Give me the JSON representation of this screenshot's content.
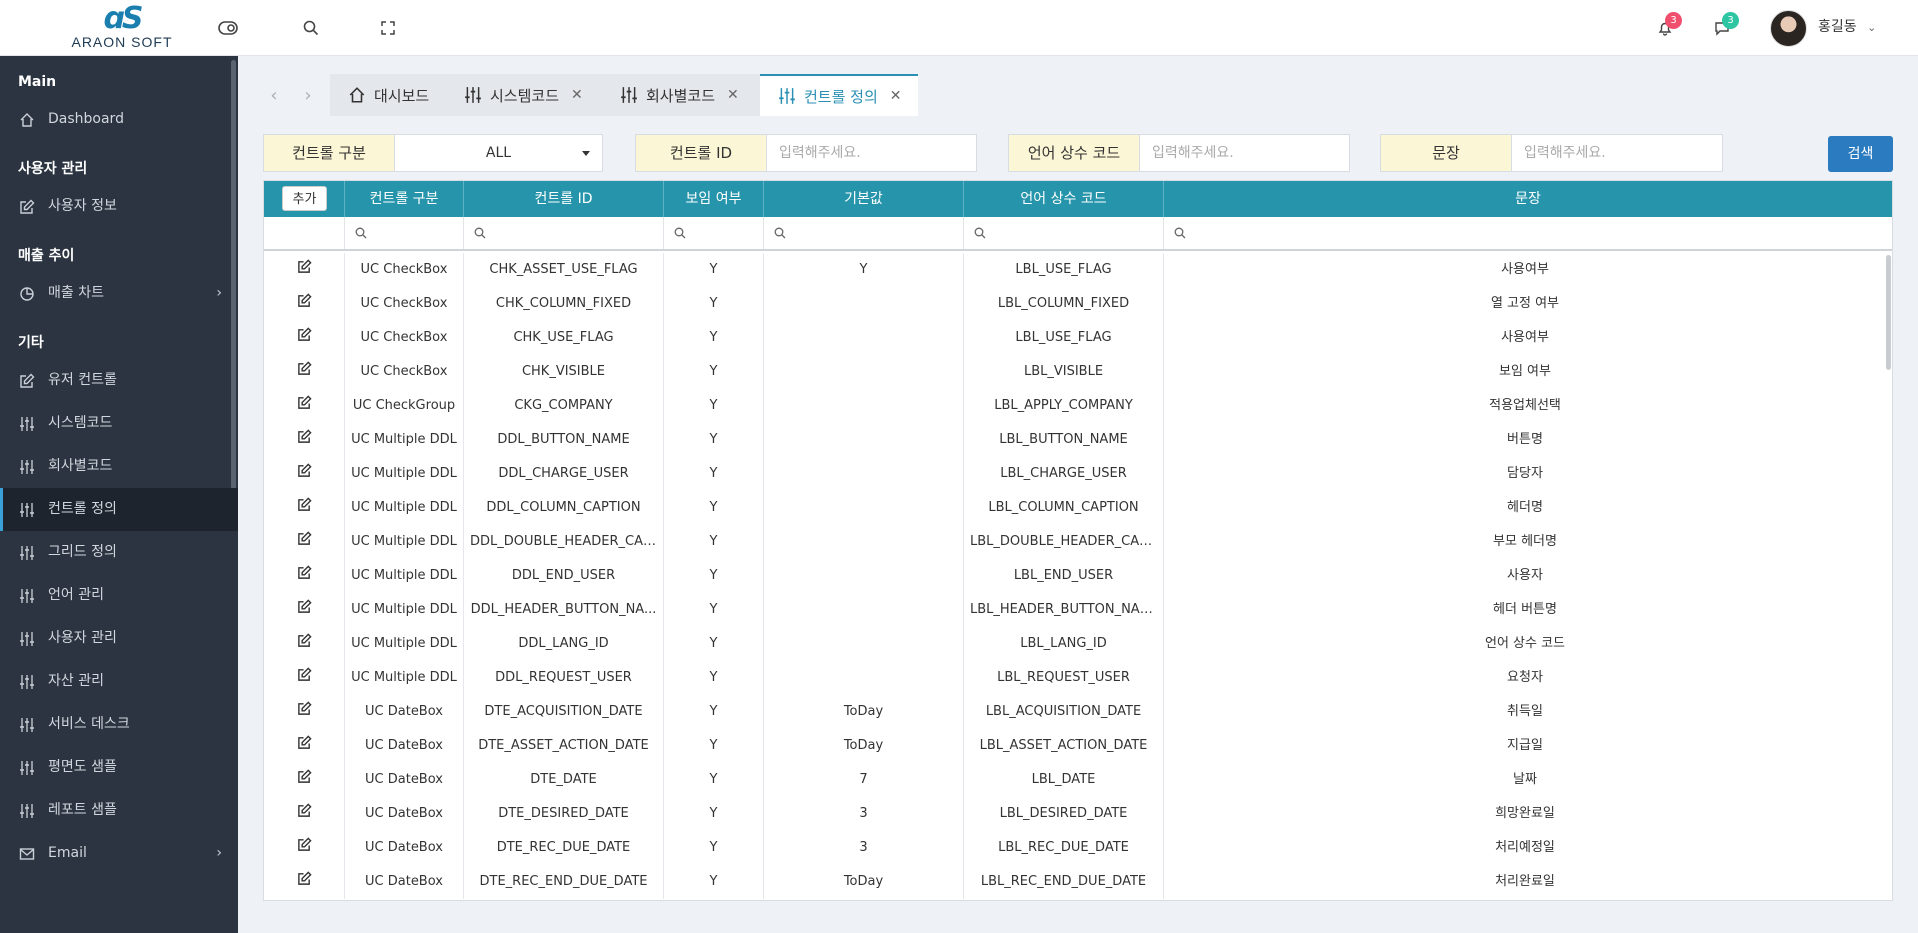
{
  "header": {
    "logo_mark": "ɑS",
    "logo_text": "ARAON SOFT",
    "notification_count": "3",
    "message_count": "3",
    "user_name": "홍길동"
  },
  "colors": {
    "accent": "#2694ab",
    "sidebar_bg": "#2b3440",
    "badge_red": "#f0506e",
    "badge_green": "#2dc5a2",
    "search_btn": "#2a7bbf"
  },
  "sidebar": {
    "sections": [
      {
        "title": "Main",
        "items": [
          {
            "label": "Dashboard",
            "icon": "home-icon"
          }
        ]
      },
      {
        "title": "사용자 관리",
        "items": [
          {
            "label": "사용자 정보",
            "icon": "edit-icon"
          }
        ]
      },
      {
        "title": "매출 추이",
        "items": [
          {
            "label": "매출 차트",
            "icon": "pie-chart-icon",
            "has_arrow": true
          }
        ]
      },
      {
        "title": "기타",
        "items": [
          {
            "label": "유저 컨트롤",
            "icon": "edit-icon"
          },
          {
            "label": "시스템코드",
            "icon": "sliders-icon"
          },
          {
            "label": "회사별코드",
            "icon": "sliders-icon"
          },
          {
            "label": "컨트롤 정의",
            "icon": "sliders-icon",
            "active": true
          },
          {
            "label": "그리드 정의",
            "icon": "sliders-icon"
          },
          {
            "label": "언어 관리",
            "icon": "sliders-icon"
          },
          {
            "label": "사용자 관리",
            "icon": "sliders-icon"
          },
          {
            "label": "자산 관리",
            "icon": "sliders-icon"
          },
          {
            "label": "서비스 데스크",
            "icon": "sliders-icon"
          },
          {
            "label": "평면도 샘플",
            "icon": "sliders-icon"
          },
          {
            "label": "레포트 샘플",
            "icon": "sliders-icon"
          },
          {
            "label": "Email",
            "icon": "mail-icon",
            "has_arrow": true
          }
        ]
      }
    ]
  },
  "tabs": [
    {
      "label": "대시보드",
      "icon": "home-icon",
      "closable": false
    },
    {
      "label": "시스템코드",
      "icon": "sliders-icon",
      "closable": true
    },
    {
      "label": "회사별코드",
      "icon": "sliders-icon",
      "closable": true
    },
    {
      "label": "컨트롤 정의",
      "icon": "sliders-icon",
      "closable": true,
      "active": true
    }
  ],
  "filters": {
    "control_type_label": "컨트롤 구분",
    "control_type_value": "ALL",
    "control_id_label": "컨트롤 ID",
    "control_id_placeholder": "입력해주세요.",
    "lang_code_label": "언어 상수 코드",
    "lang_code_placeholder": "입력해주세요.",
    "sentence_label": "문장",
    "sentence_placeholder": "입력해주세요.",
    "search_label": "검색"
  },
  "grid": {
    "add_label": "추가",
    "columns": [
      "컨트롤 구분",
      "컨트롤 ID",
      "보임 여부",
      "기본값",
      "언어 상수 코드",
      "문장"
    ],
    "rows": [
      [
        "UC CheckBox",
        "CHK_ASSET_USE_FLAG",
        "Y",
        "Y",
        "LBL_USE_FLAG",
        "사용여부"
      ],
      [
        "UC CheckBox",
        "CHK_COLUMN_FIXED",
        "Y",
        "",
        "LBL_COLUMN_FIXED",
        "열 고정 여부"
      ],
      [
        "UC CheckBox",
        "CHK_USE_FLAG",
        "Y",
        "",
        "LBL_USE_FLAG",
        "사용여부"
      ],
      [
        "UC CheckBox",
        "CHK_VISIBLE",
        "Y",
        "",
        "LBL_VISIBLE",
        "보임 여부"
      ],
      [
        "UC CheckGroup",
        "CKG_COMPANY",
        "Y",
        "",
        "LBL_APPLY_COMPANY",
        "적용업체선택"
      ],
      [
        "UC Multiple DDL",
        "DDL_BUTTON_NAME",
        "Y",
        "",
        "LBL_BUTTON_NAME",
        "버튼명"
      ],
      [
        "UC Multiple DDL",
        "DDL_CHARGE_USER",
        "Y",
        "",
        "LBL_CHARGE_USER",
        "담당자"
      ],
      [
        "UC Multiple DDL",
        "DDL_COLUMN_CAPTION",
        "Y",
        "",
        "LBL_COLUMN_CAPTION",
        "헤더명"
      ],
      [
        "UC Multiple DDL",
        "DDL_DOUBLE_HEADER_CAP...",
        "Y",
        "",
        "LBL_DOUBLE_HEADER_CAPT...",
        "부모 헤더명"
      ],
      [
        "UC Multiple DDL",
        "DDL_END_USER",
        "Y",
        "",
        "LBL_END_USER",
        "사용자"
      ],
      [
        "UC Multiple DDL",
        "DDL_HEADER_BUTTON_NA...",
        "Y",
        "",
        "LBL_HEADER_BUTTON_NAME",
        "헤더 버튼명"
      ],
      [
        "UC Multiple DDL",
        "DDL_LANG_ID",
        "Y",
        "",
        "LBL_LANG_ID",
        "언어 상수 코드"
      ],
      [
        "UC Multiple DDL",
        "DDL_REQUEST_USER",
        "Y",
        "",
        "LBL_REQUEST_USER",
        "요청자"
      ],
      [
        "UC DateBox",
        "DTE_ACQUISITION_DATE",
        "Y",
        "ToDay",
        "LBL_ACQUISITION_DATE",
        "취득일"
      ],
      [
        "UC DateBox",
        "DTE_ASSET_ACTION_DATE",
        "Y",
        "ToDay",
        "LBL_ASSET_ACTION_DATE",
        "지급일"
      ],
      [
        "UC DateBox",
        "DTE_DATE",
        "Y",
        "7",
        "LBL_DATE",
        "날짜"
      ],
      [
        "UC DateBox",
        "DTE_DESIRED_DATE",
        "Y",
        "3",
        "LBL_DESIRED_DATE",
        "희망완료일"
      ],
      [
        "UC DateBox",
        "DTE_REC_DUE_DATE",
        "Y",
        "3",
        "LBL_REC_DUE_DATE",
        "처리예정일"
      ],
      [
        "UC DateBox",
        "DTE_REC_END_DUE_DATE",
        "Y",
        "ToDay",
        "LBL_REC_END_DUE_DATE",
        "처리완료일"
      ]
    ]
  }
}
